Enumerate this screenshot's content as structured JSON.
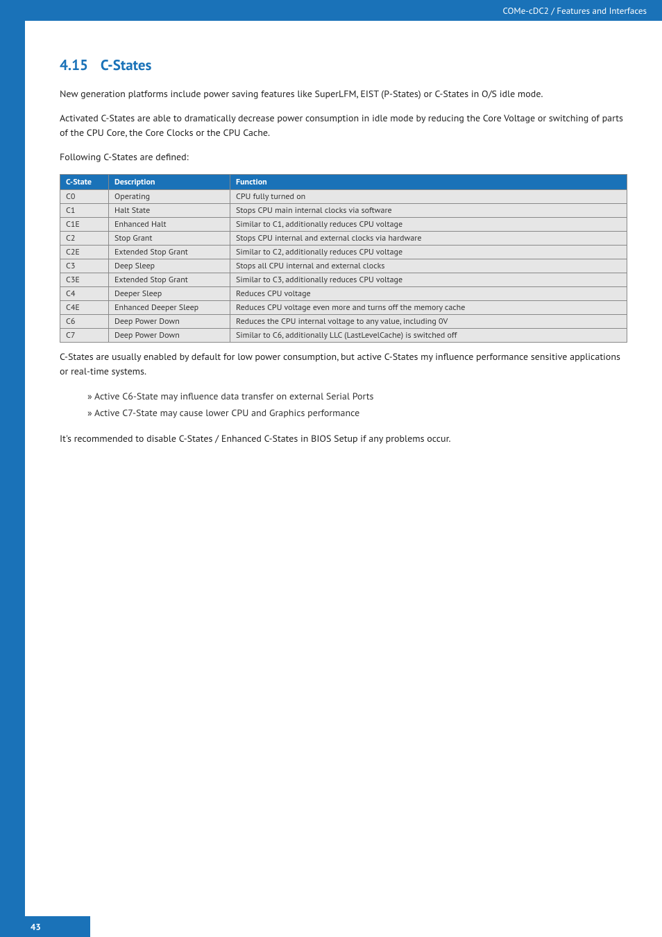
{
  "header": {
    "breadcrumb": "COMe-cDC2 / Features and Interfaces"
  },
  "section": {
    "number": "4.15",
    "title": "C-States"
  },
  "paras": {
    "p1": "New generation platforms include power saving features like SuperLFM, EIST (P-States) or C-States in O/S idle mode.",
    "p2": "Activated C-States are able to dramatically decrease power consumption in idle mode by reducing the Core Voltage or switching of parts of the CPU Core, the Core Clocks or the CPU Cache.",
    "p3": "Following C-States are defined:",
    "p4": "C-States are usually enabled by default for low power consumption, but active C-States my influence performance sensitive applications or real-time systems.",
    "p5": "It's recommended to disable C-States / Enhanced C-States in BIOS Setup if any problems occur."
  },
  "bullets": [
    "Active C6-State may influence data transfer on external Serial Ports",
    "Active C7-State may cause lower CPU and Graphics performance"
  ],
  "table": {
    "headers": [
      "C-State",
      "Description",
      "Function"
    ],
    "rows": [
      [
        "C0",
        "Operating",
        "CPU fully turned on"
      ],
      [
        "C1",
        "Halt State",
        "Stops CPU main internal clocks via software"
      ],
      [
        "C1E",
        "Enhanced Halt",
        "Similar to C1, additionally reduces CPU voltage"
      ],
      [
        "C2",
        "Stop Grant",
        "Stops CPU internal and external clocks via hardware"
      ],
      [
        "C2E",
        "Extended Stop Grant",
        "Similar to C2, additionally reduces CPU voltage"
      ],
      [
        "C3",
        "Deep Sleep",
        "Stops all CPU internal and external clocks"
      ],
      [
        "C3E",
        "Extended Stop Grant",
        "Similar to C3, additionally reduces CPU voltage"
      ],
      [
        "C4",
        "Deeper Sleep",
        "Reduces CPU voltage"
      ],
      [
        "C4E",
        "Enhanced Deeper Sleep",
        "Reduces CPU voltage even more and turns off the memory cache"
      ],
      [
        "C6",
        "Deep Power Down",
        "Reduces the CPU internal voltage to any value, including 0V"
      ],
      [
        "C7",
        "Deep Power Down",
        "Similar to C6, additionally LLC (LastLevelCache) is switched off"
      ]
    ]
  },
  "page": "43"
}
